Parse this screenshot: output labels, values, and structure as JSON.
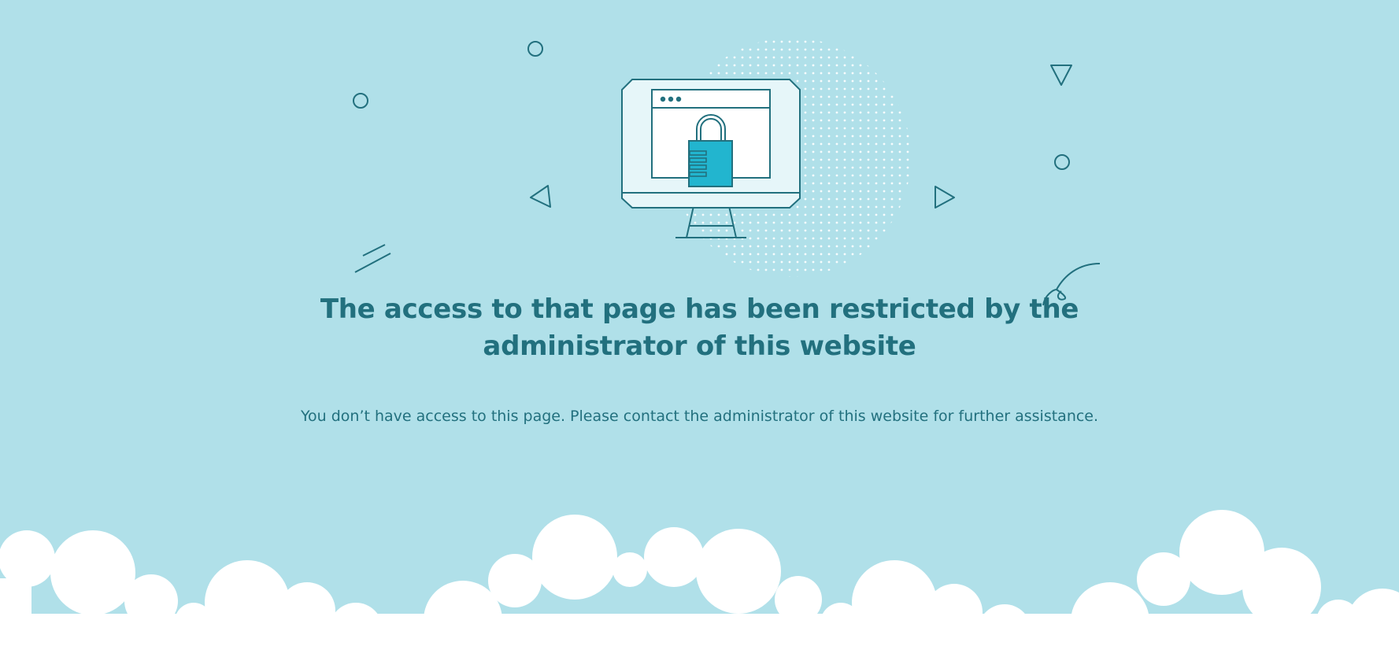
{
  "page": {
    "title": "The access to that page has been restricted by the administrator of this website",
    "message": "You don’t have access to this page. Please contact the administrator of this website for further assistance."
  },
  "colors": {
    "background": "#b0e0e9",
    "accent": "#22707e",
    "lock": "#22b5cf",
    "monitor": "#e6f6f9",
    "cloud": "#ffffff"
  },
  "icons": {
    "illustration": "monitor-with-padlock-icon"
  }
}
